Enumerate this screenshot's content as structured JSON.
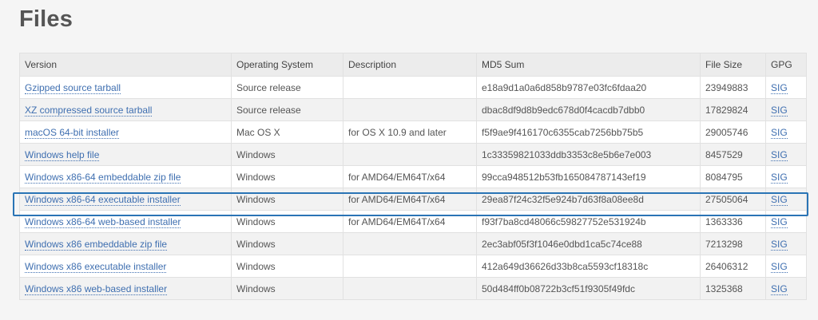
{
  "page": {
    "title": "Files"
  },
  "table": {
    "headers": [
      "Version",
      "Operating System",
      "Description",
      "MD5 Sum",
      "File Size",
      "GPG"
    ],
    "rows": [
      [
        "Gzipped source tarball",
        "Source release",
        "",
        "e18a9d1a0a6d858b9787e03fc6fdaa20",
        "23949883",
        "SIG"
      ],
      [
        "XZ compressed source tarball",
        "Source release",
        "",
        "dbac8df9d8b9edc678d0f4cacdb7dbb0",
        "17829824",
        "SIG"
      ],
      [
        "macOS 64-bit installer",
        "Mac OS X",
        "for OS X 10.9 and later",
        "f5f9ae9f416170c6355cab7256bb75b5",
        "29005746",
        "SIG"
      ],
      [
        "Windows help file",
        "Windows",
        "",
        "1c33359821033ddb3353c8e5b6e7e003",
        "8457529",
        "SIG"
      ],
      [
        "Windows x86-64 embeddable zip file",
        "Windows",
        "for AMD64/EM64T/x64",
        "99cca948512b53fb165084787143ef19",
        "8084795",
        "SIG"
      ],
      [
        "Windows x86-64 executable installer",
        "Windows",
        "for AMD64/EM64T/x64",
        "29ea87f24c32f5e924b7d63f8a08ee8d",
        "27505064",
        "SIG"
      ],
      [
        "Windows x86-64 web-based installer",
        "Windows",
        "for AMD64/EM64T/x64",
        "f93f7ba8cd48066c59827752e531924b",
        "1363336",
        "SIG"
      ],
      [
        "Windows x86 embeddable zip file",
        "Windows",
        "",
        "2ec3abf05f3f1046e0dbd1ca5c74ce88",
        "7213298",
        "SIG"
      ],
      [
        "Windows x86 executable installer",
        "Windows",
        "",
        "412a649d36626d33b8ca5593cf18318c",
        "26406312",
        "SIG"
      ],
      [
        "Windows x86 web-based installer",
        "Windows",
        "",
        "50d484ff0b08722b3cf51f9305f49fdc",
        "1325368",
        "SIG"
      ]
    ],
    "highlighted_row": 5
  },
  "colors": {
    "link": "#3f6fb0",
    "highlight_border": "#2a74b5",
    "header_bg": "#ececec",
    "title_text": "#555555"
  }
}
